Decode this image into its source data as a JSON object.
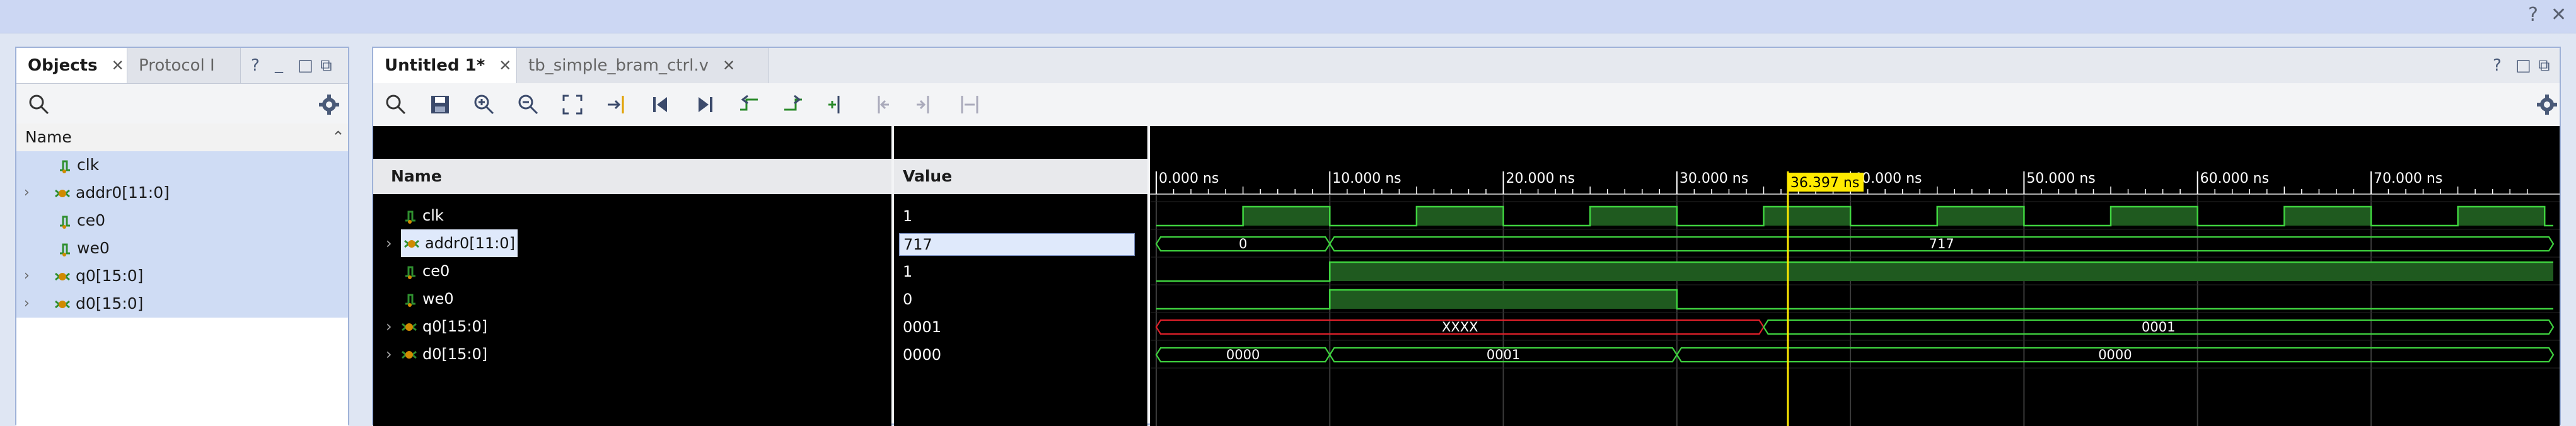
{
  "window": {
    "help_icon": "?",
    "close_icon": "✕"
  },
  "objects_panel": {
    "tabs": [
      {
        "label": "Objects",
        "close": "✕"
      },
      {
        "label": "Protocol I"
      }
    ],
    "tab_controls": [
      "?",
      "_",
      "□",
      "⧉"
    ],
    "column_header": "Name",
    "items": [
      {
        "name": "clk",
        "expandable": false,
        "kind": "bit"
      },
      {
        "name": "addr0[11:0]",
        "expandable": true,
        "kind": "bus"
      },
      {
        "name": "ce0",
        "expandable": false,
        "kind": "bit"
      },
      {
        "name": "we0",
        "expandable": false,
        "kind": "bit"
      },
      {
        "name": "q0[15:0]",
        "expandable": true,
        "kind": "bus"
      },
      {
        "name": "d0[15:0]",
        "expandable": true,
        "kind": "bus"
      }
    ]
  },
  "wave_panel": {
    "tabs": [
      {
        "label": "Untitled 1*",
        "close": "✕"
      },
      {
        "label": "tb_simple_bram_ctrl.v",
        "close": "✕"
      }
    ],
    "tab_controls": [
      "?",
      "□",
      "⧉"
    ],
    "headers": {
      "name": "Name",
      "value": "Value"
    },
    "cursor_label": "36.397 ns",
    "time_ticks": [
      "0.000 ns",
      "10.000 ns",
      "20.000 ns",
      "30.000 ns",
      "40.000 ns",
      "50.000 ns",
      "60.000 ns",
      "70.000 ns"
    ],
    "signals": [
      {
        "name": "clk",
        "value": "1",
        "expandable": false,
        "kind": "bit"
      },
      {
        "name": "addr0[11:0]",
        "value": "717",
        "expandable": true,
        "kind": "bus",
        "selected": true
      },
      {
        "name": "ce0",
        "value": "1",
        "expandable": false,
        "kind": "bit"
      },
      {
        "name": "we0",
        "value": "0",
        "expandable": false,
        "kind": "bit"
      },
      {
        "name": "q0[15:0]",
        "value": "0001",
        "expandable": true,
        "kind": "bus"
      },
      {
        "name": "d0[15:0]",
        "value": "0000",
        "expandable": true,
        "kind": "bus"
      }
    ]
  },
  "chart_data": {
    "type": "waveform",
    "time_unit": "ns",
    "xlim": [
      0,
      80.5
    ],
    "cursor_ns": 36.397,
    "clk": {
      "period": 10,
      "first_rise": 5,
      "end": 80.5
    },
    "ce0": [
      {
        "t": 0,
        "v": 0
      },
      {
        "t": 10,
        "v": 1
      }
    ],
    "we0": [
      {
        "t": 0,
        "v": 0
      },
      {
        "t": 10,
        "v": 1
      },
      {
        "t": 30,
        "v": 0
      }
    ],
    "buses": {
      "addr0": [
        {
          "t0": 0,
          "t1": 10,
          "label": "0"
        },
        {
          "t0": 10,
          "t1": 80.5,
          "label": "717"
        }
      ],
      "q0": [
        {
          "t0": 0,
          "t1": 35,
          "label": "XXXX",
          "unknown": true
        },
        {
          "t0": 35,
          "t1": 80.5,
          "label": "0001"
        }
      ],
      "d0": [
        {
          "t0": 0,
          "t1": 10,
          "label": "0000"
        },
        {
          "t0": 10,
          "t1": 30,
          "label": "0001"
        },
        {
          "t0": 30,
          "t1": 80.5,
          "label": "0000"
        }
      ]
    },
    "colors": {
      "wave": "#3fd33f",
      "fill": "#1f5a1f",
      "unknown": "#e0202a",
      "cursor": "#ffea00",
      "grid": "#3a3a3a"
    }
  }
}
